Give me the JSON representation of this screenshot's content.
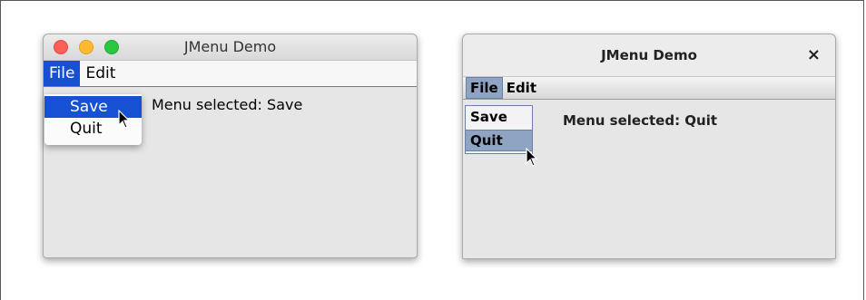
{
  "mac_window": {
    "title": "JMenu Demo",
    "menus": [
      {
        "label": "File",
        "active": true
      },
      {
        "label": "Edit",
        "active": false
      }
    ],
    "dropdown_items": [
      {
        "label": "Save",
        "selected": true
      },
      {
        "label": "Quit",
        "selected": false
      }
    ],
    "status_text": "Menu selected: Save",
    "accent_color": "#1651d4"
  },
  "java_window": {
    "title": "JMenu Demo",
    "close_glyph": "×",
    "menus": [
      {
        "label": "File",
        "active": true
      },
      {
        "label": "Edit",
        "active": false
      }
    ],
    "dropdown_items": [
      {
        "label": "Save",
        "selected": false
      },
      {
        "label": "Quit",
        "selected": true
      }
    ],
    "status_text": "Menu selected: Quit",
    "accent_color": "#8ea4c2"
  },
  "icons": {
    "cursor": "arrow-cursor-icon",
    "traffic_lights": [
      "close-light-icon",
      "minimize-light-icon",
      "zoom-light-icon"
    ]
  }
}
